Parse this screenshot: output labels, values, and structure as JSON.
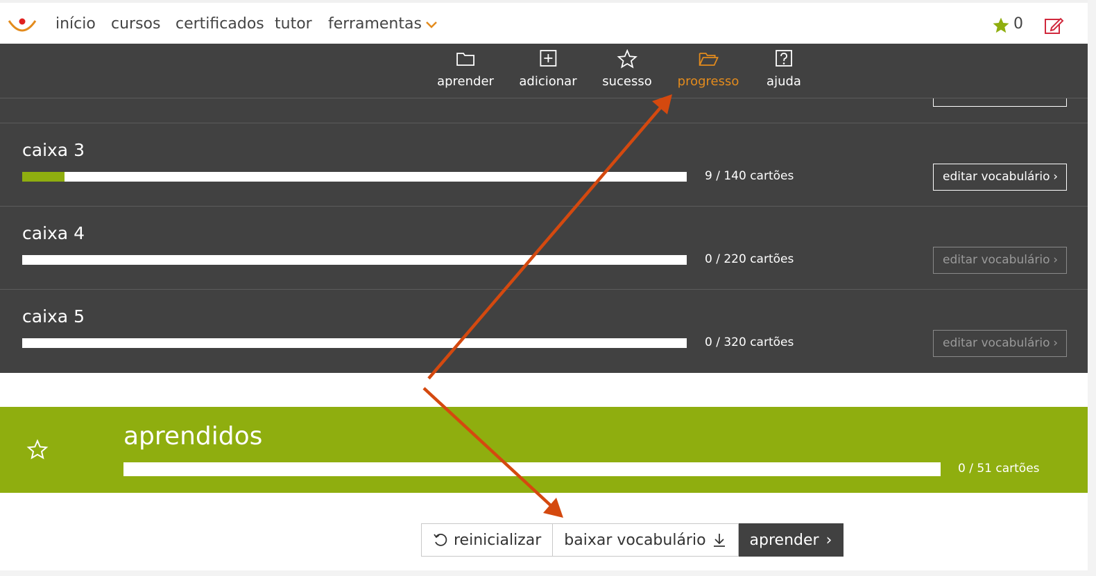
{
  "topnav": {
    "links": [
      "início",
      "cursos",
      "certificados",
      "tutor",
      "ferramentas"
    ],
    "star_count": "0"
  },
  "subnav": {
    "items": [
      {
        "label": "aprender",
        "icon": "folder-icon"
      },
      {
        "label": "adicionar",
        "icon": "plus-square-icon"
      },
      {
        "label": "sucesso",
        "icon": "star-outline-icon"
      },
      {
        "label": "progresso",
        "icon": "open-folder-icon",
        "active": true
      },
      {
        "label": "ajuda",
        "icon": "help-icon"
      }
    ]
  },
  "boxes": [
    {
      "title": "caixa 3",
      "count": "9 / 140 cartões",
      "progress": 0.064,
      "button": "editar vocabulário",
      "enabled": true
    },
    {
      "title": "caixa 4",
      "count": "0 / 220 cartões",
      "progress": 0,
      "button": "editar vocabulário",
      "enabled": false
    },
    {
      "title": "caixa 5",
      "count": "0 / 320 cartões",
      "progress": 0,
      "button": "editar vocabulário",
      "enabled": false
    }
  ],
  "learned": {
    "title": "aprendidos",
    "count": "0 / 51 cartões",
    "progress": 0
  },
  "actions": {
    "reset": "reinicializar",
    "download": "baixar vocabulário",
    "learn": "aprender"
  },
  "colors": {
    "accent_orange": "#e38b1d",
    "green": "#8fae0f",
    "dark_panel": "#414141",
    "annotation_arrow": "#d4490f",
    "edit_icon": "#d0283c"
  }
}
